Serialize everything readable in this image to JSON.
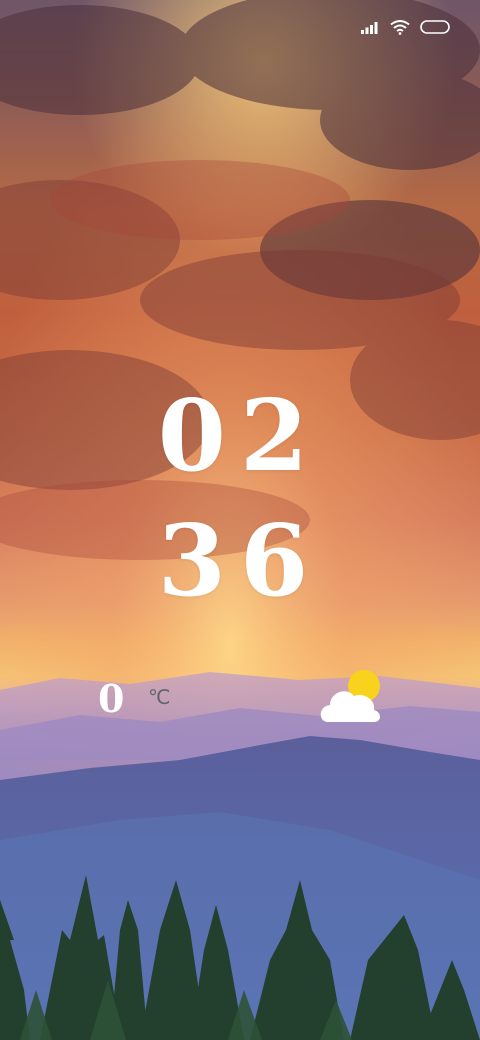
{
  "status_bar": {
    "icons": [
      "signal-icon",
      "wifi-icon",
      "battery-icon"
    ]
  },
  "clock": {
    "hours": "02",
    "minutes": "36"
  },
  "weather": {
    "temperature": "0",
    "unit": "℃",
    "icon": "partly-cloudy-icon"
  },
  "wallpaper": {
    "description_icon": "sunset-mountain-wallpaper"
  }
}
